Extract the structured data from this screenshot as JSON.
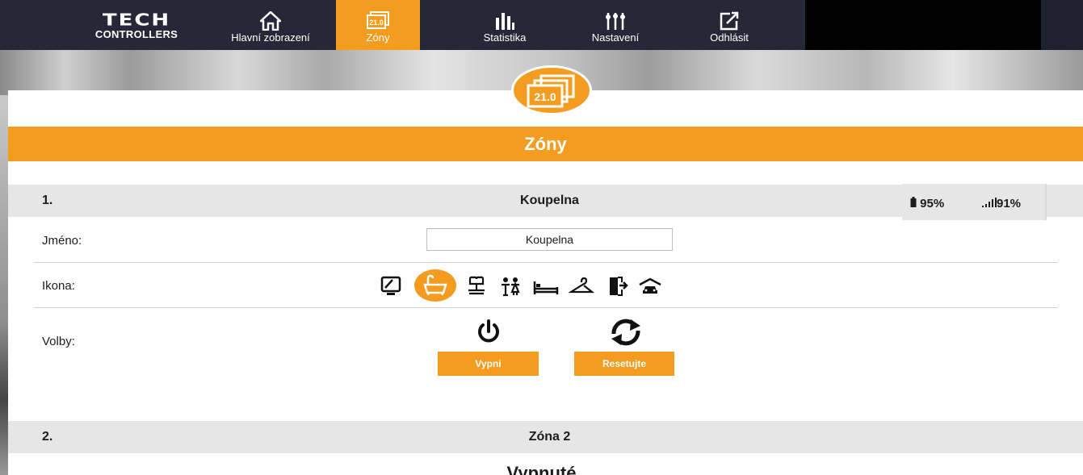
{
  "nav": {
    "logo_main": "TECH",
    "logo_sub": "CONTROLLERS",
    "items": [
      {
        "label": "Hlavní zobrazení",
        "icon": "home-icon"
      },
      {
        "label": "Zóny",
        "icon": "zones-icon",
        "active": true
      },
      {
        "label": "Statistika",
        "icon": "bar-chart-icon"
      },
      {
        "label": "Nastavení",
        "icon": "sliders-icon"
      },
      {
        "label": "Odhlásit",
        "icon": "logout-icon"
      }
    ]
  },
  "badge": {
    "value": "21.0"
  },
  "page": {
    "title": "Zóny"
  },
  "zone1": {
    "number": "1.",
    "name": "Koupelna",
    "battery": "95%",
    "signal": "91%",
    "name_label": "Jméno:",
    "name_value": "Koupelna",
    "icon_label": "Ikona:",
    "options_label": "Volby:",
    "icons": [
      "monitor-icon",
      "bathtub-icon",
      "sink-icon",
      "children-icon",
      "bed-icon",
      "hanger-icon",
      "door-exit-icon",
      "car-garage-icon"
    ],
    "selected_icon": "bathtub-icon",
    "off_button": "Vypni",
    "reset_button": "Resetujte"
  },
  "zone2": {
    "number": "2.",
    "name": "Zóna 2",
    "status": "Vypnuté"
  },
  "colors": {
    "accent": "#f39c1f",
    "nav_bg": "#262837",
    "section_bg": "#e6e6e6"
  }
}
